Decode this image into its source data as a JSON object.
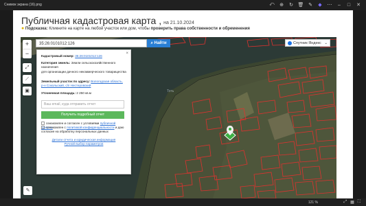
{
  "window": {
    "title": "Снимок экрана (16).png"
  },
  "header": {
    "title": "Публичная кадастровая карта ,",
    "date": "на 21.10.2024",
    "hint_label": "Подсказка:",
    "hint_text": " Кликните на карте на любой участок или дом, чтобы ",
    "hint_bold": "проверить права собственности и обременения"
  },
  "search": {
    "value": "35:26:0101012:126",
    "button": "Найти"
  },
  "layer": {
    "label": "Спутник Яндекс"
  },
  "map": {
    "label": "Тоть"
  },
  "popup": {
    "cad_label": "Кадастровый номер:",
    "cad_value": "35:26:0101012:126",
    "cat_label": "Категория земель:",
    "cat_value": "Земли сельскохозяйственного назначения",
    "use_value": "для организации дачного некоммерческого товарищества",
    "addr_label": "Земельный участок по адресу:",
    "addr_value": "Вологодская область, р-н Сокольский, с/п Нестеровский",
    "area_label": "Уточненная площадь:",
    "area_value": "2 250 кв.м",
    "email_placeholder": "Ваш email, куда отправить отчет",
    "get_button": "Получить подробный отчет",
    "agree1_a": "ознакомлен и согласен с условиями",
    "agree1_link": "публичной оферты",
    "agree2_a": "ознакомлен с",
    "agree2_link": "политикой конфиденциальности",
    "agree2_b": "и даю согласие на обработку персональных данных",
    "details_link": "Детали отчета и юридическая информация",
    "manual_link": "Ручной выбор параметров"
  },
  "bottom": {
    "zoom": "121 %"
  }
}
